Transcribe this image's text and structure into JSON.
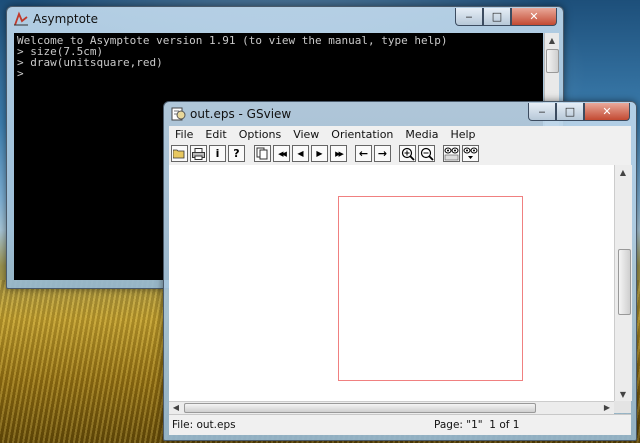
{
  "asymptote_window": {
    "title": "Asymptote",
    "console_lines": [
      "Welcome to Asymptote version 1.91 (to view the manual, type help)",
      "> size(7.5cm)",
      "> draw(unitsquare,red)",
      ">"
    ]
  },
  "gsview_window": {
    "title": "out.eps - GSview",
    "menu": [
      "File",
      "Edit",
      "Options",
      "View",
      "Orientation",
      "Media",
      "Help"
    ],
    "toolbar_glyphs": {
      "info": "i",
      "help": "?",
      "prev_page": "◀",
      "next_page": "▶",
      "first_page": "◀◀",
      "last_page": "▶▶",
      "back": "←",
      "forward": "→"
    },
    "status_file": "File: out.eps",
    "status_page": "Page: \"1\"  1 of 1"
  },
  "window_controls": {
    "minimize": "‒",
    "maximize": "□",
    "close": "✕"
  },
  "colors": {
    "square_stroke": "#f08080",
    "console_bg": "#000000",
    "console_text": "#c9c9c9"
  }
}
